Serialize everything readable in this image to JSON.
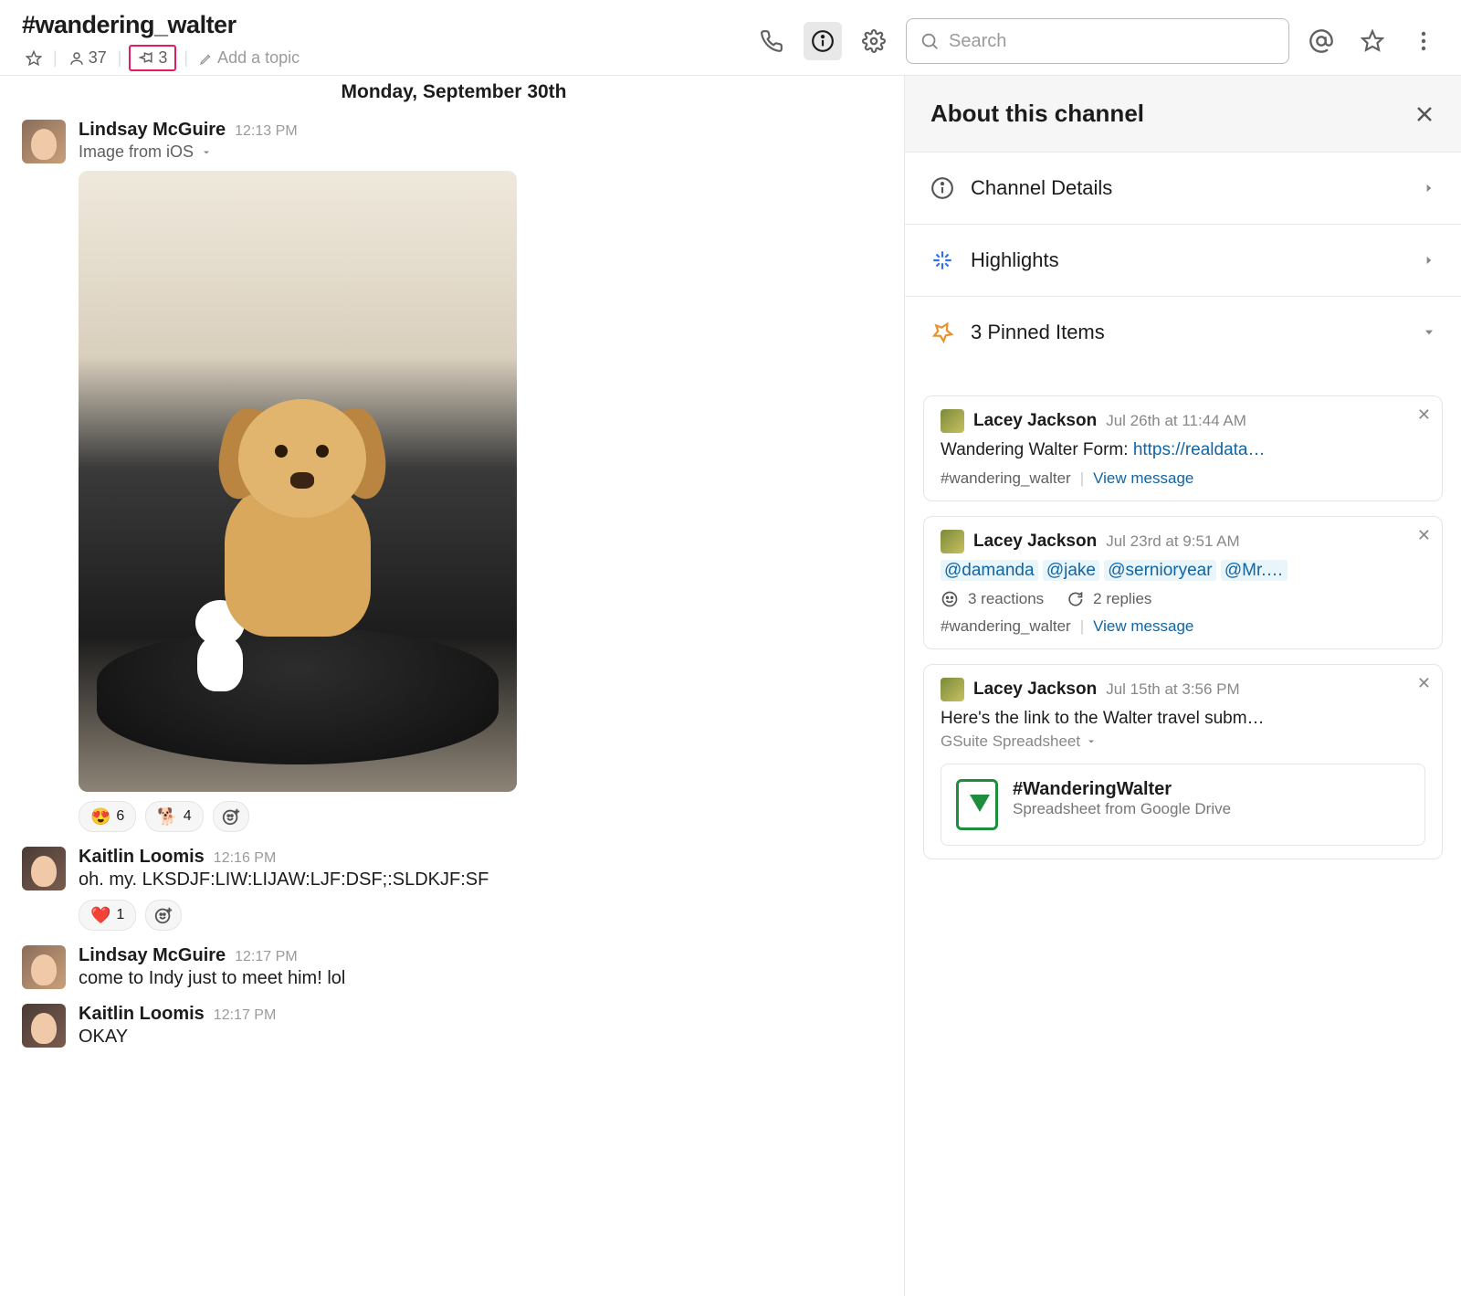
{
  "header": {
    "channel_name": "#wandering_walter",
    "member_count": "37",
    "pinned_count": "3",
    "topic_placeholder": "Add a topic",
    "search_placeholder": "Search"
  },
  "date_divider": "Monday, September 30th",
  "messages": [
    {
      "author": "Lindsay McGuire",
      "time": "12:13 PM",
      "subline": "Image from iOS",
      "reactions": [
        {
          "emoji": "😍",
          "count": "6"
        },
        {
          "emoji": "🐕",
          "count": "4"
        }
      ]
    },
    {
      "author": "Kaitlin Loomis",
      "time": "12:16 PM",
      "text": "oh. my. LKSDJF:LIW:LIJAW:LJF:DSF;:SLDKJF:SF",
      "reactions": [
        {
          "emoji": "❤️",
          "count": "1"
        }
      ]
    },
    {
      "author": "Lindsay McGuire",
      "time": "12:17 PM",
      "text": "come to Indy just to meet him! lol"
    },
    {
      "author": "Kaitlin Loomis",
      "time": "12:17 PM",
      "text": "OKAY"
    }
  ],
  "sidepanel": {
    "title": "About this channel",
    "rows": {
      "details": "Channel Details",
      "highlights": "Highlights",
      "pinned": "3 Pinned Items"
    },
    "pins": [
      {
        "author": "Lacey Jackson",
        "time": "Jul 26th at 11:44 AM",
        "text_prefix": "Wandering Walter Form: ",
        "link": "https://realdata…",
        "channel": "#wandering_walter",
        "view": "View message"
      },
      {
        "author": "Lacey Jackson",
        "time": "Jul 23rd at 9:51 AM",
        "mentions": [
          "@damanda",
          "@jake",
          "@sernioryear",
          "@Mr.…"
        ],
        "reactions_label": "3 reactions",
        "replies_label": "2 replies",
        "channel": "#wandering_walter",
        "view": "View message"
      },
      {
        "author": "Lacey Jackson",
        "time": "Jul 15th at 3:56 PM",
        "text": "Here's the link to the Walter travel subm…",
        "attachment_label": "GSuite Spreadsheet",
        "gs_title": "#WanderingWalter",
        "gs_sub": "Spreadsheet from Google Drive"
      }
    ]
  }
}
